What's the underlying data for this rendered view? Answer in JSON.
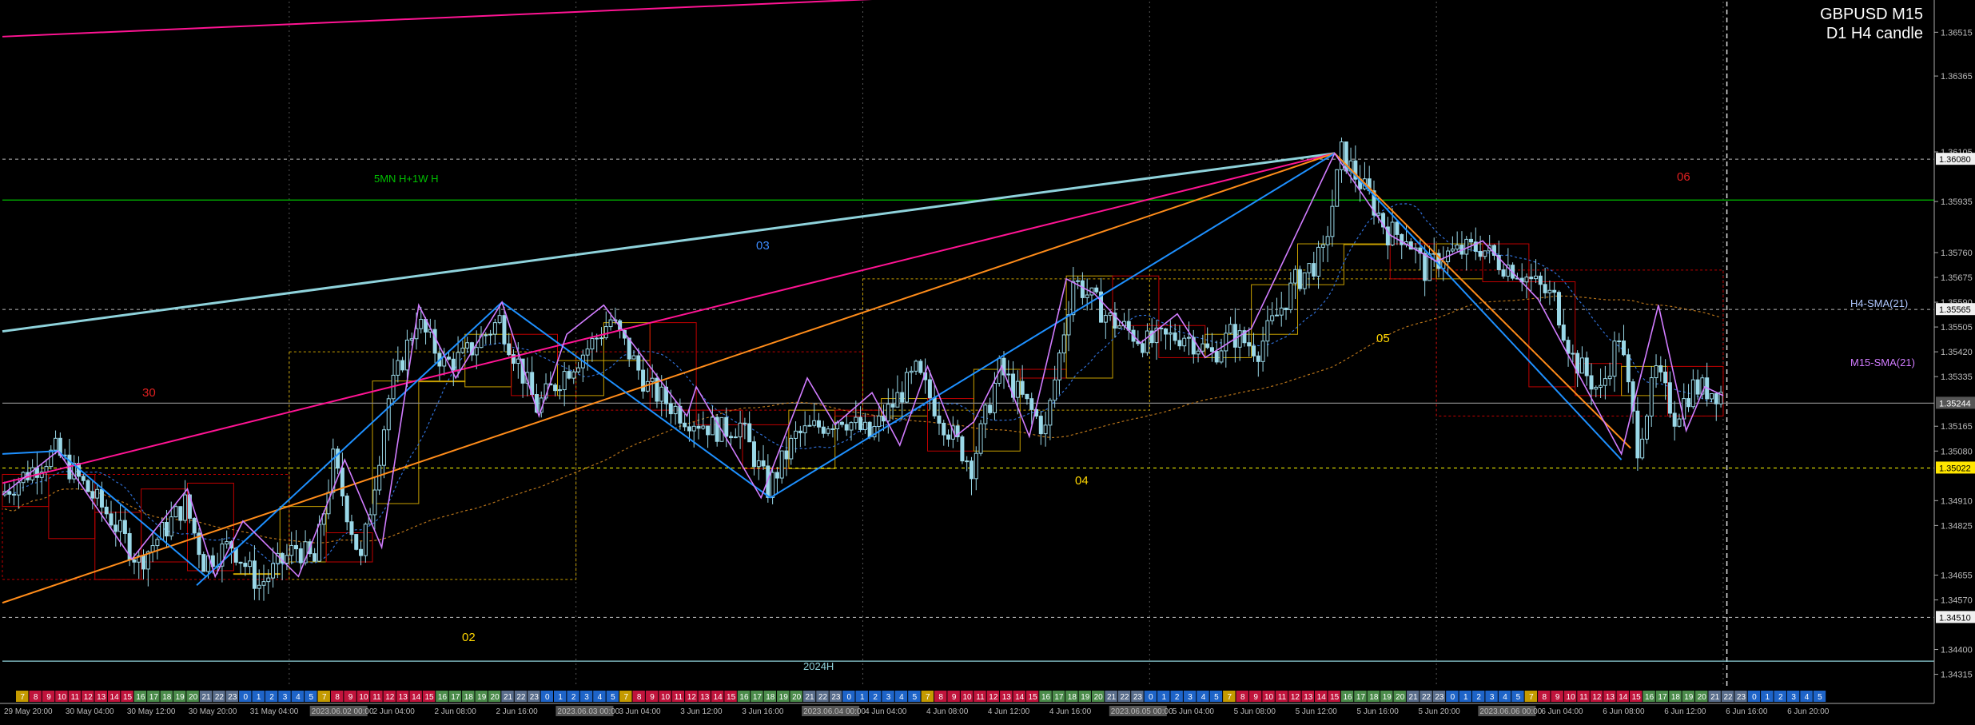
{
  "header": {
    "symbol": "GBPUSD M15",
    "sub": "D1 H4 candle"
  },
  "colors": {
    "bg": "#000000",
    "candle": "#9ad8e8",
    "bull_box": "#c8a000",
    "bear_box": "#c00000",
    "pink": "#ff1493",
    "orange": "#ff8c1a",
    "blue": "#1e90ff",
    "teal": "#8fd3dc",
    "zigzag": "#d17cff",
    "green": "#00c000",
    "level_yellow": "#ffff00"
  },
  "labels": {
    "mn_w": "5MN H+1W H",
    "h2024": "2024H",
    "day30": "30",
    "day02": "02",
    "day03": "03",
    "day04": "04",
    "day05": "05",
    "day06": "06",
    "h4_sma": "H4-SMA(21)",
    "m15_sma": "M15-SMA(21)"
  },
  "price_tags": [
    {
      "text": "1.36080",
      "price": 1.3608,
      "style": "white"
    },
    {
      "text": "1.35565",
      "price": 1.35565,
      "style": "white"
    },
    {
      "text": "1.35244",
      "price": 1.35244,
      "style": "gray"
    },
    {
      "text": "1.35022",
      "price": 1.35022,
      "style": "yellow"
    },
    {
      "text": "1.34510",
      "price": 1.3451,
      "style": "white"
    }
  ],
  "session_bar": {
    "groups": [
      {
        "start": 7,
        "n": 7,
        "color": "#c49a00"
      },
      {
        "start": 8,
        "n": 8,
        "color": "#c0143c"
      },
      {
        "start": 16,
        "n": 5,
        "color": "#4b8c4b"
      },
      {
        "start": 21,
        "n": 3,
        "color": "#5a6e8c"
      },
      {
        "start": 0,
        "n": 6,
        "color": "#1e64c8"
      }
    ]
  },
  "time_axis": [
    "29 May 20:00",
    "30 May 04:00",
    "30 May 12:00",
    "30 May 20:00",
    "31 May 04:00",
    "2023.06.02 00:00",
    "2 Jun 04:00",
    "2 Jun 08:00",
    "2 Jun 16:00",
    "2023.06.03 00:00",
    "3 Jun 04:00",
    "3 Jun 12:00",
    "3 Jun 16:00",
    "2023.06.04 00:00",
    "4 Jun 04:00",
    "4 Jun 08:00",
    "4 Jun 12:00",
    "4 Jun 16:00",
    "2023.06.05 00:00",
    "5 Jun 04:00",
    "5 Jun 08:00",
    "5 Jun 12:00",
    "5 Jun 16:00",
    "5 Jun 20:00",
    "2023.06.06 00:00",
    "6 Jun 04:00",
    "6 Jun 08:00",
    "6 Jun 12:00",
    "6 Jun 16:00",
    "6 Jun 20:00"
  ],
  "chart_data": {
    "type": "candlestick",
    "title": "GBPUSD M15",
    "ylim": [
      1.3427,
      1.3662
    ],
    "y_ticks": [
      1.36515,
      1.36365,
      1.36105,
      1.35935,
      1.3576,
      1.35675,
      1.3559,
      1.35505,
      1.3542,
      1.35335,
      1.35165,
      1.3508,
      1.3491,
      1.34825,
      1.34655,
      1.3457,
      1.344,
      1.34315
    ],
    "y_tick_text": [
      "1.36515",
      "1.36365",
      "1.36105",
      "1.35935",
      "1.35760",
      "1.35675",
      "1.35590",
      "1.35505",
      "1.35420",
      "1.35335",
      "1.35165",
      "1.35080",
      "1.34910",
      "1.34825",
      "1.34655",
      "1.34570",
      "1.34400",
      "1.34315"
    ],
    "x_span": [
      0,
      100
    ],
    "path_anchors": [
      [
        0,
        1.3493
      ],
      [
        3,
        1.3508
      ],
      [
        6,
        1.3485
      ],
      [
        7.5,
        1.347
      ],
      [
        10,
        1.349
      ],
      [
        11,
        1.347
      ],
      [
        12.5,
        1.3476
      ],
      [
        14,
        1.3462
      ],
      [
        16,
        1.3475
      ],
      [
        17,
        1.347
      ],
      [
        18,
        1.3505
      ],
      [
        19.5,
        1.347
      ],
      [
        21,
        1.3526
      ],
      [
        22.5,
        1.3553
      ],
      [
        24,
        1.3538
      ],
      [
        25,
        1.354
      ],
      [
        27,
        1.3553
      ],
      [
        29,
        1.3523
      ],
      [
        30.5,
        1.3535
      ],
      [
        32,
        1.3545
      ],
      [
        33,
        1.3553
      ],
      [
        35,
        1.353
      ],
      [
        37,
        1.352
      ],
      [
        39,
        1.3515
      ],
      [
        40,
        1.3517
      ],
      [
        41.5,
        1.3495
      ],
      [
        43,
        1.3513
      ],
      [
        45.5,
        1.352
      ],
      [
        47,
        1.3513
      ],
      [
        49.5,
        1.3535
      ],
      [
        51,
        1.3518
      ],
      [
        52.5,
        1.3503
      ],
      [
        54,
        1.3536
      ],
      [
        55,
        1.3528
      ],
      [
        56.5,
        1.3515
      ],
      [
        58,
        1.3567
      ],
      [
        60,
        1.3553
      ],
      [
        62,
        1.3545
      ],
      [
        64,
        1.3548
      ],
      [
        65.5,
        1.3541
      ],
      [
        66.5,
        1.3548
      ],
      [
        68,
        1.3543
      ],
      [
        70,
        1.3566
      ],
      [
        71.5,
        1.3575
      ],
      [
        72.5,
        1.361
      ],
      [
        74,
        1.3595
      ],
      [
        75,
        1.3583
      ],
      [
        76,
        1.3582
      ],
      [
        77,
        1.357
      ],
      [
        78,
        1.3575
      ],
      [
        80,
        1.3578
      ],
      [
        81,
        1.3573
      ],
      [
        82,
        1.357
      ],
      [
        84,
        1.356
      ],
      [
        85,
        1.354
      ],
      [
        86.5,
        1.3528
      ],
      [
        87.5,
        1.3548
      ],
      [
        88.5,
        1.351
      ],
      [
        89.5,
        1.3535
      ],
      [
        90.5,
        1.352
      ],
      [
        91.5,
        1.353
      ],
      [
        93,
        1.3528
      ]
    ],
    "zigzag": [
      [
        0,
        1.3493
      ],
      [
        3,
        1.3508
      ],
      [
        7,
        1.3471
      ],
      [
        10,
        1.3495
      ],
      [
        11.5,
        1.3465
      ],
      [
        13,
        1.3484
      ],
      [
        16,
        1.3465
      ],
      [
        18.5,
        1.3505
      ],
      [
        20.5,
        1.3475
      ],
      [
        22.5,
        1.3558
      ],
      [
        24.5,
        1.3533
      ],
      [
        27,
        1.3559
      ],
      [
        29,
        1.352
      ],
      [
        30.5,
        1.3548
      ],
      [
        32.5,
        1.3558
      ],
      [
        37,
        1.352
      ],
      [
        37.5,
        1.353
      ],
      [
        41,
        1.3492
      ],
      [
        43.5,
        1.3533
      ],
      [
        45,
        1.3517
      ],
      [
        47,
        1.3528
      ],
      [
        48.5,
        1.351
      ],
      [
        50,
        1.3537
      ],
      [
        51.5,
        1.3513
      ],
      [
        52.5,
        1.3518
      ],
      [
        54,
        1.3537
      ],
      [
        55.5,
        1.3513
      ],
      [
        57.5,
        1.3567
      ],
      [
        59,
        1.3562
      ],
      [
        61.5,
        1.3545
      ],
      [
        63.5,
        1.3555
      ],
      [
        65,
        1.354
      ],
      [
        67.5,
        1.355
      ],
      [
        72,
        1.361
      ],
      [
        75,
        1.3582
      ],
      [
        77.5,
        1.3573
      ],
      [
        80,
        1.358
      ],
      [
        81.5,
        1.357
      ],
      [
        83,
        1.356
      ],
      [
        87.5,
        1.3507
      ],
      [
        88,
        1.352
      ],
      [
        89.5,
        1.3558
      ],
      [
        91,
        1.3515
      ],
      [
        92,
        1.353
      ],
      [
        93,
        1.3527
      ]
    ],
    "trend_lines": [
      {
        "color": "pink",
        "from": [
          0,
          1.365
        ],
        "to": [
          55,
          1.3665
        ]
      },
      {
        "color": "teal",
        "from": [
          0,
          1.3549
        ],
        "to": [
          72,
          1.361
        ]
      },
      {
        "color": "pink",
        "from": [
          0,
          1.3497
        ],
        "to": [
          72,
          1.361
        ]
      },
      {
        "color": "orange",
        "from": [
          0,
          1.3456
        ],
        "to": [
          72,
          1.361
        ]
      },
      {
        "color": "blue",
        "from": [
          10.5,
          1.3462
        ],
        "to": [
          27,
          1.3559
        ]
      },
      {
        "color": "blue",
        "from": [
          27,
          1.3559
        ],
        "to": [
          41.5,
          1.3492
        ]
      },
      {
        "color": "blue",
        "from": [
          41.5,
          1.3492
        ],
        "to": [
          72,
          1.361
        ]
      },
      {
        "color": "blue",
        "from": [
          72,
          1.361
        ],
        "to": [
          87.5,
          1.3505
        ]
      },
      {
        "color": "orange",
        "from": [
          72,
          1.361
        ],
        "to": [
          88,
          1.3509
        ]
      },
      {
        "color": "blue",
        "from": [
          0,
          1.3507
        ],
        "to": [
          3,
          1.3508
        ]
      },
      {
        "color": "blue",
        "from": [
          3,
          1.3508
        ],
        "to": [
          11,
          1.3465
        ]
      }
    ],
    "h_levels": [
      {
        "price": 1.3608,
        "style": "dash",
        "color": "#bbbbbb"
      },
      {
        "price": 1.3594,
        "style": "solid",
        "color": "green"
      },
      {
        "price": 1.35565,
        "style": "dash",
        "color": "#bbbbbb"
      },
      {
        "price": 1.35244,
        "style": "solid",
        "color": "#888888"
      },
      {
        "price": 1.35022,
        "style": "dash",
        "color": "level_yellow"
      },
      {
        "price": 1.3451,
        "style": "dash",
        "color": "#bbbbbb"
      },
      {
        "price": 1.3436,
        "style": "solid",
        "color": "teal"
      }
    ],
    "h4_boxes": [
      {
        "x0": 0,
        "x1": 2.5,
        "o": 1.35,
        "c": 1.3489
      },
      {
        "x0": 2.5,
        "x1": 5,
        "o": 1.35,
        "c": 1.3478
      },
      {
        "x0": 5,
        "x1": 7.5,
        "o": 1.3487,
        "c": 1.3464
      },
      {
        "x0": 7.5,
        "x1": 10,
        "o": 1.3495,
        "c": 1.347
      },
      {
        "x0": 10,
        "x1": 12.5,
        "o": 1.3497,
        "c": 1.3467
      },
      {
        "x0": 12.5,
        "x1": 15,
        "o": 1.3466,
        "c": 1.3466
      },
      {
        "x0": 15,
        "x1": 17.5,
        "o": 1.347,
        "c": 1.3489
      },
      {
        "x0": 17.5,
        "x1": 20,
        "o": 1.348,
        "c": 1.347
      },
      {
        "x0": 20,
        "x1": 22.5,
        "o": 1.349,
        "c": 1.3532
      },
      {
        "x0": 22.5,
        "x1": 25,
        "o": 1.3532,
        "c": 1.3532
      },
      {
        "x0": 25,
        "x1": 27.5,
        "o": 1.353,
        "c": 1.3548
      },
      {
        "x0": 27.5,
        "x1": 30,
        "o": 1.3548,
        "c": 1.3527
      },
      {
        "x0": 30,
        "x1": 32.5,
        "o": 1.3527,
        "c": 1.3539
      },
      {
        "x0": 32.5,
        "x1": 35,
        "o": 1.3539,
        "c": 1.3552
      },
      {
        "x0": 35,
        "x1": 37.5,
        "o": 1.3552,
        "c": 1.3522
      },
      {
        "x0": 37.5,
        "x1": 40,
        "o": 1.3522,
        "c": 1.3517
      },
      {
        "x0": 40,
        "x1": 42.5,
        "o": 1.3517,
        "c": 1.3502
      },
      {
        "x0": 42.5,
        "x1": 45,
        "o": 1.3502,
        "c": 1.3522
      },
      {
        "x0": 45,
        "x1": 47.5,
        "o": 1.3522,
        "c": 1.352
      },
      {
        "x0": 47.5,
        "x1": 50,
        "o": 1.352,
        "c": 1.3526
      },
      {
        "x0": 50,
        "x1": 52.5,
        "o": 1.3526,
        "c": 1.3508
      },
      {
        "x0": 52.5,
        "x1": 55,
        "o": 1.3508,
        "c": 1.3536
      },
      {
        "x0": 55,
        "x1": 57.5,
        "o": 1.3536,
        "c": 1.3533
      },
      {
        "x0": 57.5,
        "x1": 60,
        "o": 1.3533,
        "c": 1.3568
      },
      {
        "x0": 60,
        "x1": 62.5,
        "o": 1.3568,
        "c": 1.3551
      },
      {
        "x0": 62.5,
        "x1": 65,
        "o": 1.3551,
        "c": 1.354
      },
      {
        "x0": 65,
        "x1": 67.5,
        "o": 1.354,
        "c": 1.3548
      },
      {
        "x0": 67.5,
        "x1": 70,
        "o": 1.3548,
        "c": 1.3565
      },
      {
        "x0": 70,
        "x1": 72.5,
        "o": 1.3565,
        "c": 1.3579
      },
      {
        "x0": 72.5,
        "x1": 75,
        "o": 1.3579,
        "c": 1.3579
      },
      {
        "x0": 75,
        "x1": 77.5,
        "o": 1.3579,
        "c": 1.3567
      },
      {
        "x0": 77.5,
        "x1": 80,
        "o": 1.3567,
        "c": 1.3579
      },
      {
        "x0": 80,
        "x1": 82.5,
        "o": 1.3579,
        "c": 1.3566
      },
      {
        "x0": 82.5,
        "x1": 85,
        "o": 1.3566,
        "c": 1.353
      },
      {
        "x0": 85,
        "x1": 87.5,
        "o": 1.3538,
        "c": 1.3527
      },
      {
        "x0": 87.5,
        "x1": 90,
        "o": 1.3527,
        "c": 1.3537
      },
      {
        "x0": 90,
        "x1": 93,
        "o": 1.3537,
        "c": 1.352
      }
    ],
    "day_boxes": [
      {
        "x0": 0,
        "x1": 15.5,
        "o": 1.35,
        "c": 1.3464,
        "bull": false
      },
      {
        "x0": 15.5,
        "x1": 31,
        "o": 1.3464,
        "c": 1.3542,
        "bull": true
      },
      {
        "x0": 31,
        "x1": 46.5,
        "o": 1.3542,
        "c": 1.3522,
        "bull": false
      },
      {
        "x0": 46.5,
        "x1": 62,
        "o": 1.3522,
        "c": 1.3567,
        "bull": true
      },
      {
        "x0": 62,
        "x1": 77.5,
        "o": 1.3567,
        "c": 1.357,
        "bull": true
      },
      {
        "x0": 77.5,
        "x1": 93,
        "o": 1.357,
        "c": 1.352,
        "bull": false
      }
    ]
  }
}
